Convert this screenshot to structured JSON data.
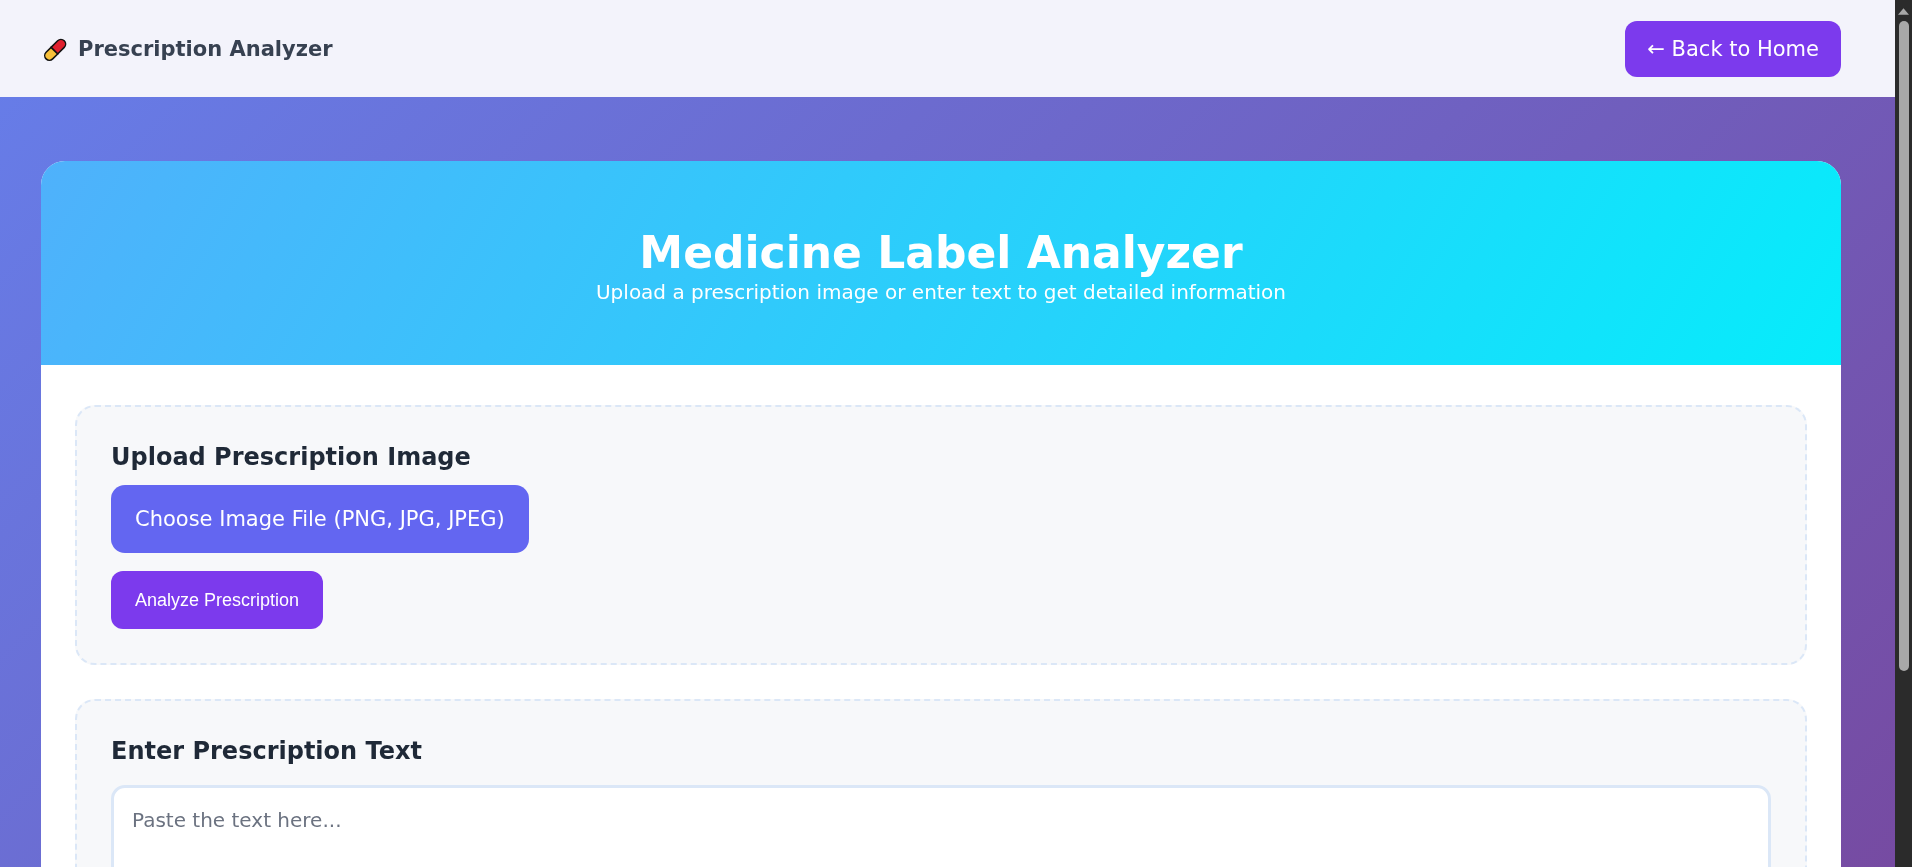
{
  "navbar": {
    "brand": "Prescription Analyzer",
    "back_button": "← Back to Home"
  },
  "header": {
    "title": "Medicine Label Analyzer",
    "subtitle": "Upload a prescription image or enter text to get detailed information"
  },
  "upload_section": {
    "heading": "Upload Prescription Image",
    "file_button": "Choose Image File (PNG, JPG, JPEG)",
    "analyze_button": "Analyze Prescription"
  },
  "text_section": {
    "heading": "Enter Prescription Text",
    "textarea": {
      "placeholder": "Paste the text here..."
    }
  }
}
